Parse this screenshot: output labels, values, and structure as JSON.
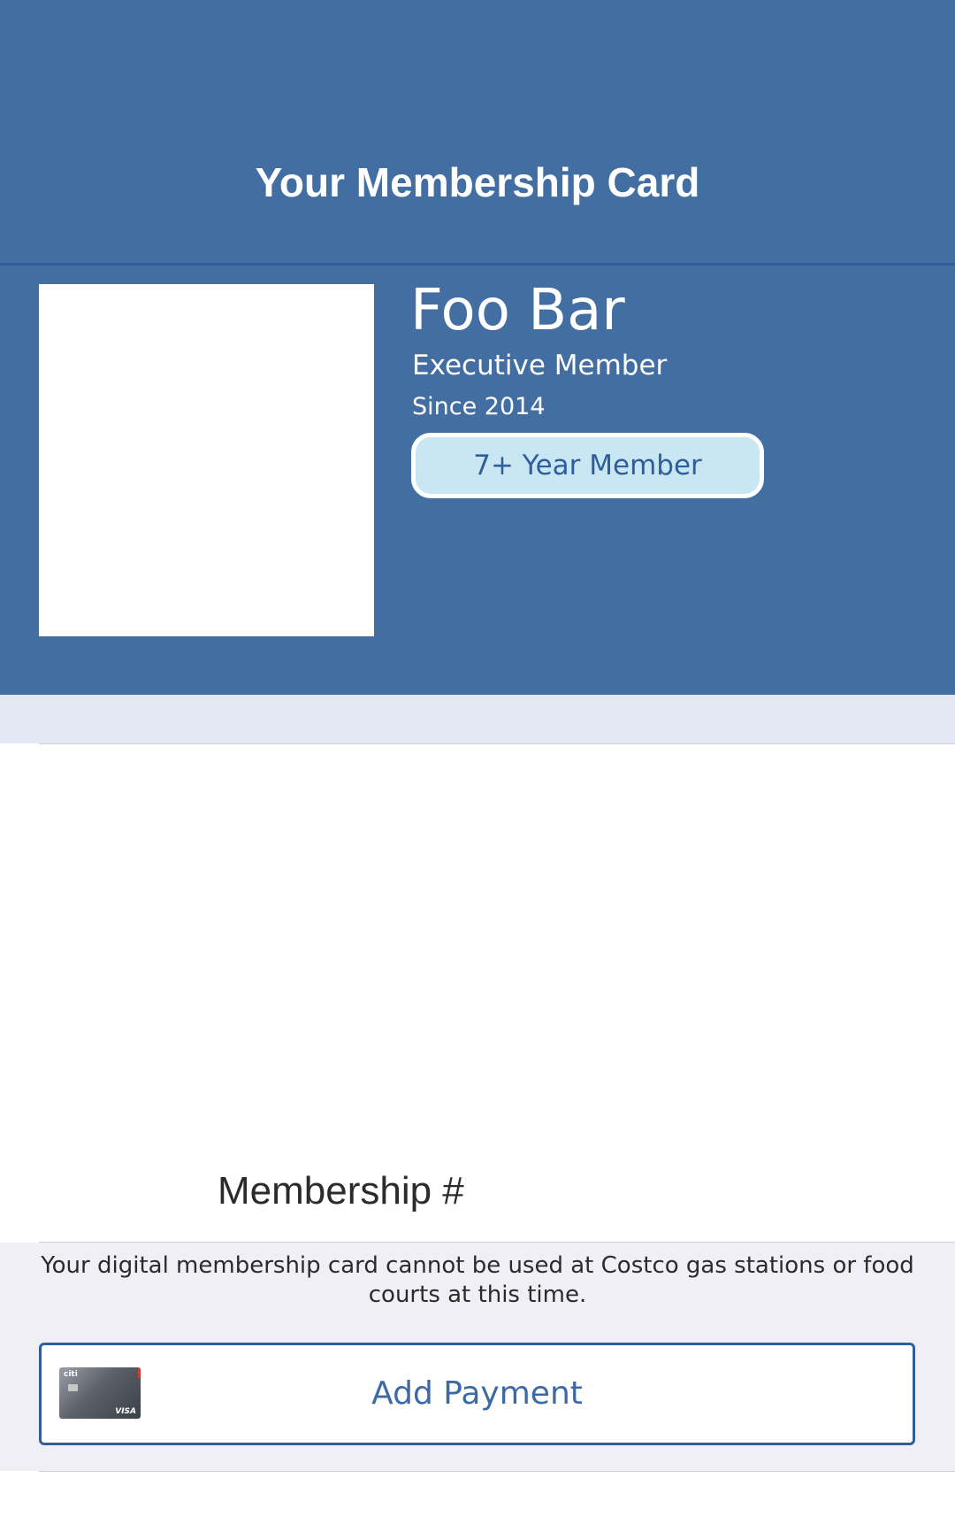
{
  "header": {
    "title": "Your Membership Card"
  },
  "member": {
    "name": "Foo Bar",
    "tier": "Executive Member",
    "since": "Since 2014",
    "tenure_badge": "7+ Year Member"
  },
  "card": {
    "membership_label": "Membership #"
  },
  "notice": {
    "text": "Your digital membership card cannot be used at Costco gas stations or food courts at this time."
  },
  "payment": {
    "button_label": "Add Payment",
    "card_brand": "citi",
    "card_network": "VISA",
    "card_icon": "credit-card-icon"
  },
  "colors": {
    "header_blue": "#426ea2",
    "badge_fill": "#c9e6f3",
    "accent_blue": "#2f5e9b",
    "band": "#e1e7f3",
    "notice_bg": "#f0eff5"
  }
}
